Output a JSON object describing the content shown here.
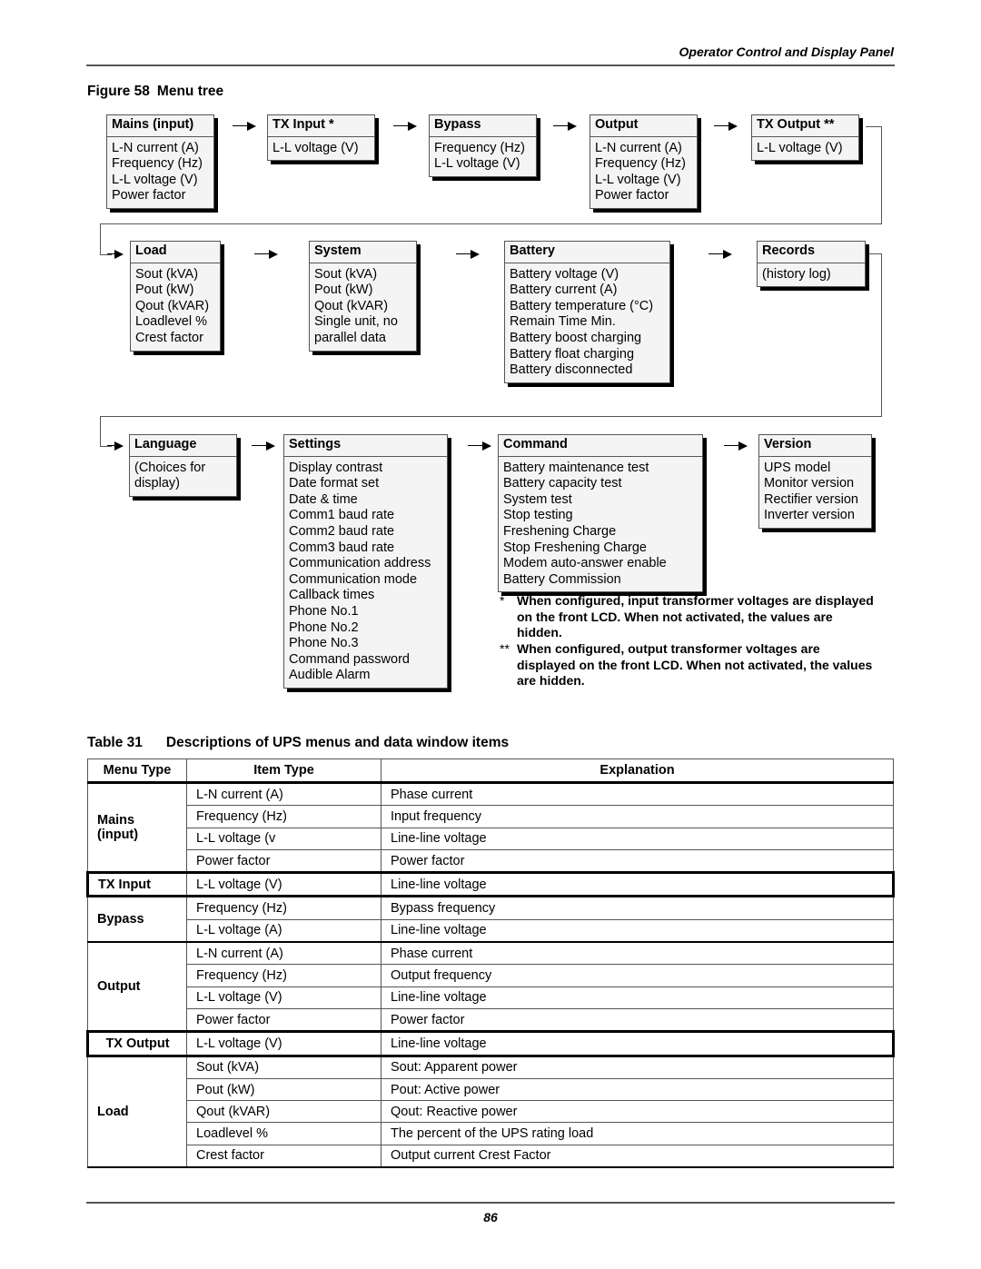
{
  "header": {
    "section_title": "Operator Control and Display Panel"
  },
  "figure": {
    "label": "Figure 58",
    "title": "Menu tree",
    "menus": [
      {
        "title": "Mains (input)",
        "items": [
          "L-N current (A)",
          "Frequency (Hz)",
          "L-L voltage (V)",
          "Power factor"
        ]
      },
      {
        "title": "TX Input *",
        "items": [
          "L-L voltage (V)"
        ]
      },
      {
        "title": "Bypass",
        "items": [
          "Frequency (Hz)",
          "L-L voltage (V)"
        ]
      },
      {
        "title": "Output",
        "items": [
          "L-N current (A)",
          "Frequency (Hz)",
          "L-L voltage (V)",
          "Power factor"
        ]
      },
      {
        "title": "TX Output **",
        "items": [
          "L-L voltage (V)"
        ]
      },
      {
        "title": "Load",
        "items": [
          "Sout (kVA)",
          "Pout (kW)",
          "Qout (kVAR)",
          "Loadlevel %",
          "Crest factor"
        ]
      },
      {
        "title": "System",
        "items": [
          "Sout (kVA)",
          "Pout (kW)",
          "Qout (kVAR)",
          "Single unit, no",
          "parallel data"
        ]
      },
      {
        "title": "Battery",
        "items": [
          "Battery voltage (V)",
          "Battery current (A)",
          "Battery temperature (°C)",
          "Remain Time Min.",
          "Battery boost charging",
          "Battery float charging",
          "Battery disconnected"
        ]
      },
      {
        "title": "Records",
        "items": [
          "(history log)"
        ]
      },
      {
        "title": "Language",
        "items": [
          "(Choices for",
          "display)"
        ]
      },
      {
        "title": "Settings",
        "items": [
          "Display contrast",
          "Date format set",
          "Date & time",
          "Comm1 baud rate",
          "Comm2 baud rate",
          "Comm3 baud rate",
          "Communication address",
          "Communication mode",
          "Callback times",
          "Phone No.1",
          "Phone No.2",
          "Phone No.3",
          "Command password",
          "Audible Alarm"
        ]
      },
      {
        "title": "Command",
        "items": [
          "Battery maintenance test",
          "Battery capacity test",
          "System test",
          "Stop testing",
          "Freshening Charge",
          "Stop Freshening Charge",
          "Modem auto-answer enable",
          "Battery Commission"
        ]
      },
      {
        "title": "Version",
        "items": [
          "UPS model",
          "Monitor version",
          "Rectifier version",
          "Inverter version"
        ]
      }
    ],
    "notes": [
      {
        "mark": "*",
        "text": "When configured, input transformer voltages are displayed on the front LCD. When not activated, the values are hidden."
      },
      {
        "mark": "**",
        "text": "When configured, output transformer voltages are displayed on the front LCD. When not activated, the values are hidden."
      }
    ]
  },
  "table": {
    "label": "Table 31",
    "title": "Descriptions of UPS menus and data window items",
    "headers": [
      "Menu Type",
      "Item Type",
      "Explanation"
    ],
    "groups": [
      {
        "menu": "Mains (input)",
        "rows": [
          [
            "L-N current (A)",
            "Phase current"
          ],
          [
            "Frequency (Hz)",
            "Input frequency"
          ],
          [
            "L-L voltage (v",
            "Line-line voltage"
          ],
          [
            "Power factor",
            "Power factor"
          ]
        ]
      },
      {
        "menu": "TX Input",
        "rows": [
          [
            "L-L voltage (V)",
            "Line-line voltage"
          ]
        ]
      },
      {
        "menu": "Bypass",
        "rows": [
          [
            "Frequency (Hz)",
            "Bypass frequency"
          ],
          [
            "L-L voltage (A)",
            "Line-line voltage"
          ]
        ]
      },
      {
        "menu": "Output",
        "rows": [
          [
            "L-N current (A)",
            "Phase current"
          ],
          [
            "Frequency (Hz)",
            "Output frequency"
          ],
          [
            "L-L voltage (V)",
            "Line-line voltage"
          ],
          [
            "Power factor",
            "Power factor"
          ]
        ]
      },
      {
        "menu": "TX Output",
        "rows": [
          [
            "L-L voltage (V)",
            "Line-line voltage"
          ]
        ]
      },
      {
        "menu": "Load",
        "rows": [
          [
            "Sout (kVA)",
            "Sout: Apparent power"
          ],
          [
            "Pout (kW)",
            "Pout: Active power"
          ],
          [
            "Qout (kVAR)",
            "Qout: Reactive power"
          ],
          [
            "Loadlevel %",
            "The percent of the UPS rating load"
          ],
          [
            "Crest factor",
            "Output current Crest Factor"
          ]
        ]
      }
    ]
  },
  "footer": {
    "page_number": "86"
  }
}
